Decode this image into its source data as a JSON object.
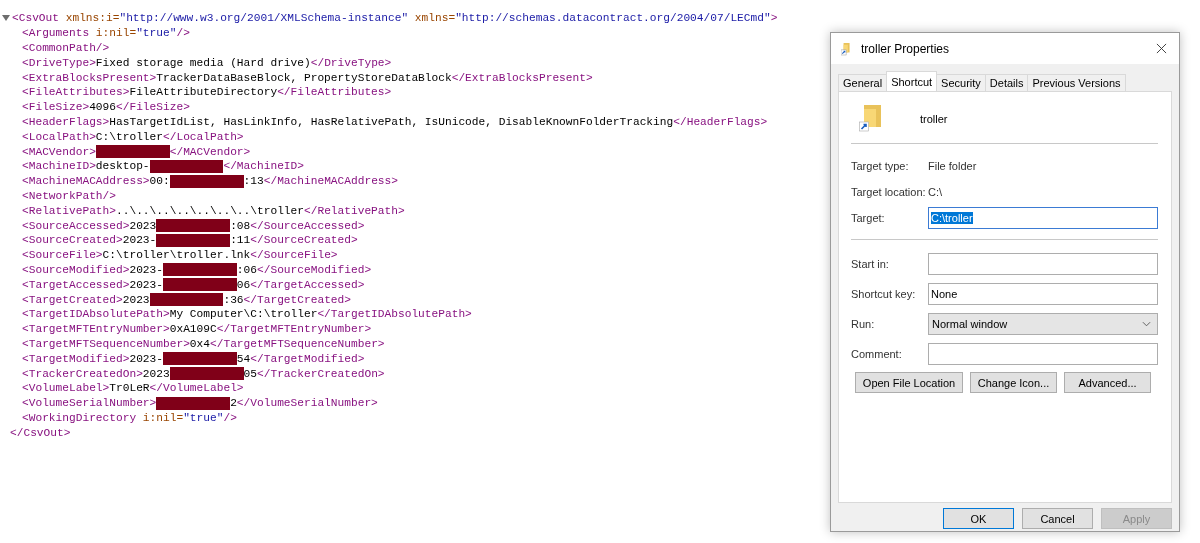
{
  "xml": {
    "expanded": true,
    "open": [
      {
        "kind": "tag",
        "text": "<CsvOut"
      },
      {
        "kind": "attr",
        "text": " xmlns:i="
      },
      {
        "kind": "value",
        "text": "\"http://www.w3.org/2001/XMLSchema-instance\""
      },
      {
        "kind": "attr",
        "text": " xmlns="
      },
      {
        "kind": "value",
        "text": "\"http://schemas.datacontract.org/2004/07/LECmd\""
      },
      {
        "kind": "tag",
        "text": ">"
      }
    ],
    "children": [
      [
        {
          "kind": "tag",
          "text": "<Arguments"
        },
        {
          "kind": "attr",
          "text": " i:nil="
        },
        {
          "kind": "value",
          "text": "\"true\""
        },
        {
          "kind": "tag",
          "text": "/>"
        }
      ],
      [
        {
          "kind": "tag",
          "text": "<CommonPath/>"
        }
      ],
      [
        {
          "kind": "tag",
          "text": "<DriveType>"
        },
        {
          "kind": "text",
          "text": "Fixed storage media (Hard drive)"
        },
        {
          "kind": "tag",
          "text": "</DriveType>"
        }
      ],
      [
        {
          "kind": "tag",
          "text": "<ExtraBlocksPresent>"
        },
        {
          "kind": "text",
          "text": "TrackerDataBaseBlock, PropertyStoreDataBlock"
        },
        {
          "kind": "tag",
          "text": "</ExtraBlocksPresent>"
        }
      ],
      [
        {
          "kind": "tag",
          "text": "<FileAttributes>"
        },
        {
          "kind": "text",
          "text": "FileAttributeDirectory"
        },
        {
          "kind": "tag",
          "text": "</FileAttributes>"
        }
      ],
      [
        {
          "kind": "tag",
          "text": "<FileSize>"
        },
        {
          "kind": "text",
          "text": "4096"
        },
        {
          "kind": "tag",
          "text": "</FileSize>"
        }
      ],
      [
        {
          "kind": "tag",
          "text": "<HeaderFlags>"
        },
        {
          "kind": "text",
          "text": "HasTargetIdList, HasLinkInfo, HasRelativePath, IsUnicode, DisableKnownFolderTracking"
        },
        {
          "kind": "tag",
          "text": "</HeaderFlags>"
        }
      ],
      [
        {
          "kind": "tag",
          "text": "<LocalPath>"
        },
        {
          "kind": "text",
          "text": "C:\\troller"
        },
        {
          "kind": "tag",
          "text": "</LocalPath>"
        }
      ],
      [
        {
          "kind": "tag",
          "text": "<MACVendor>"
        },
        {
          "kind": "redacted"
        },
        {
          "kind": "tag",
          "text": "</MACVendor>"
        }
      ],
      [
        {
          "kind": "tag",
          "text": "<MachineID>"
        },
        {
          "kind": "text",
          "text": "desktop-"
        },
        {
          "kind": "redacted"
        },
        {
          "kind": "tag",
          "text": "</MachineID>"
        }
      ],
      [
        {
          "kind": "tag",
          "text": "<MachineMACAddress>"
        },
        {
          "kind": "text",
          "text": "00:"
        },
        {
          "kind": "redacted"
        },
        {
          "kind": "text",
          "text": ":13"
        },
        {
          "kind": "tag",
          "text": "</MachineMACAddress>"
        }
      ],
      [
        {
          "kind": "tag",
          "text": "<NetworkPath/>"
        }
      ],
      [
        {
          "kind": "tag",
          "text": "<RelativePath>"
        },
        {
          "kind": "text",
          "text": "..\\..\\..\\..\\..\\..\\..\\troller"
        },
        {
          "kind": "tag",
          "text": "</RelativePath>"
        }
      ],
      [
        {
          "kind": "tag",
          "text": "<SourceAccessed>"
        },
        {
          "kind": "text",
          "text": "2023"
        },
        {
          "kind": "redacted"
        },
        {
          "kind": "text",
          "text": ":08"
        },
        {
          "kind": "tag",
          "text": "</SourceAccessed>"
        }
      ],
      [
        {
          "kind": "tag",
          "text": "<SourceCreated>"
        },
        {
          "kind": "text",
          "text": "2023-"
        },
        {
          "kind": "redacted"
        },
        {
          "kind": "text",
          "text": ":11"
        },
        {
          "kind": "tag",
          "text": "</SourceCreated>"
        }
      ],
      [
        {
          "kind": "tag",
          "text": "<SourceFile>"
        },
        {
          "kind": "text",
          "text": "C:\\troller\\troller.lnk"
        },
        {
          "kind": "tag",
          "text": "</SourceFile>"
        }
      ],
      [
        {
          "kind": "tag",
          "text": "<SourceModified>"
        },
        {
          "kind": "text",
          "text": "2023-"
        },
        {
          "kind": "redacted"
        },
        {
          "kind": "text",
          "text": ":06"
        },
        {
          "kind": "tag",
          "text": "</SourceModified>"
        }
      ],
      [
        {
          "kind": "tag",
          "text": "<TargetAccessed>"
        },
        {
          "kind": "text",
          "text": "2023-"
        },
        {
          "kind": "redacted"
        },
        {
          "kind": "text",
          "text": "06"
        },
        {
          "kind": "tag",
          "text": "</TargetAccessed>"
        }
      ],
      [
        {
          "kind": "tag",
          "text": "<TargetCreated>"
        },
        {
          "kind": "text",
          "text": "2023"
        },
        {
          "kind": "redacted"
        },
        {
          "kind": "text",
          "text": ":36"
        },
        {
          "kind": "tag",
          "text": "</TargetCreated>"
        }
      ],
      [
        {
          "kind": "tag",
          "text": "<TargetIDAbsolutePath>"
        },
        {
          "kind": "text",
          "text": "My Computer\\C:\\troller"
        },
        {
          "kind": "tag",
          "text": "</TargetIDAbsolutePath>"
        }
      ],
      [
        {
          "kind": "tag",
          "text": "<TargetMFTEntryNumber>"
        },
        {
          "kind": "text",
          "text": "0xA109C"
        },
        {
          "kind": "tag",
          "text": "</TargetMFTEntryNumber>"
        }
      ],
      [
        {
          "kind": "tag",
          "text": "<TargetMFTSequenceNumber>"
        },
        {
          "kind": "text",
          "text": "0x4"
        },
        {
          "kind": "tag",
          "text": "</TargetMFTSequenceNumber>"
        }
      ],
      [
        {
          "kind": "tag",
          "text": "<TargetModified>"
        },
        {
          "kind": "text",
          "text": "2023-"
        },
        {
          "kind": "redacted"
        },
        {
          "kind": "text",
          "text": "54"
        },
        {
          "kind": "tag",
          "text": "</TargetModified>"
        }
      ],
      [
        {
          "kind": "tag",
          "text": "<TrackerCreatedOn>"
        },
        {
          "kind": "text",
          "text": "2023"
        },
        {
          "kind": "redacted"
        },
        {
          "kind": "text",
          "text": "05"
        },
        {
          "kind": "tag",
          "text": "</TrackerCreatedOn>"
        }
      ],
      [
        {
          "kind": "tag",
          "text": "<VolumeLabel>"
        },
        {
          "kind": "text",
          "text": "Tr0LeR"
        },
        {
          "kind": "tag",
          "text": "</VolumeLabel>"
        }
      ],
      [
        {
          "kind": "tag",
          "text": "<VolumeSerialNumber>"
        },
        {
          "kind": "redacted"
        },
        {
          "kind": "text",
          "text": "2"
        },
        {
          "kind": "tag",
          "text": "</VolumeSerialNumber>"
        }
      ],
      [
        {
          "kind": "tag",
          "text": "<WorkingDirectory"
        },
        {
          "kind": "attr",
          "text": " i:nil="
        },
        {
          "kind": "value",
          "text": "\"true\""
        },
        {
          "kind": "tag",
          "text": "/>"
        }
      ]
    ],
    "close": [
      {
        "kind": "tag",
        "text": "</CsvOut>"
      }
    ]
  },
  "dialog": {
    "title": "troller Properties",
    "tabs": [
      {
        "label": "General",
        "selected": false
      },
      {
        "label": "Shortcut",
        "selected": true
      },
      {
        "label": "Security",
        "selected": false
      },
      {
        "label": "Details",
        "selected": false
      },
      {
        "label": "Previous Versions",
        "selected": false
      }
    ],
    "name": "troller",
    "info": [
      {
        "label": "Target type:",
        "value": "File folder"
      },
      {
        "label": "Target location:",
        "value": "C:\\"
      }
    ],
    "target": {
      "label": "Target:",
      "value": "C:\\troller",
      "highlighted": true
    },
    "fields": [
      {
        "kind": "text",
        "label": "Start in:"
      },
      {
        "kind": "text",
        "label": "Shortcut key:",
        "value": "None"
      },
      {
        "kind": "select",
        "label": "Run:",
        "value": "Normal window"
      },
      {
        "kind": "text",
        "label": "Comment:"
      }
    ],
    "actions": [
      "Open File Location",
      "Change Icon...",
      "Advanced..."
    ],
    "buttons": [
      {
        "label": "OK",
        "default": true,
        "disabled": false
      },
      {
        "label": "Cancel",
        "default": false,
        "disabled": false
      },
      {
        "label": "Apply",
        "default": false,
        "disabled": true
      }
    ]
  }
}
